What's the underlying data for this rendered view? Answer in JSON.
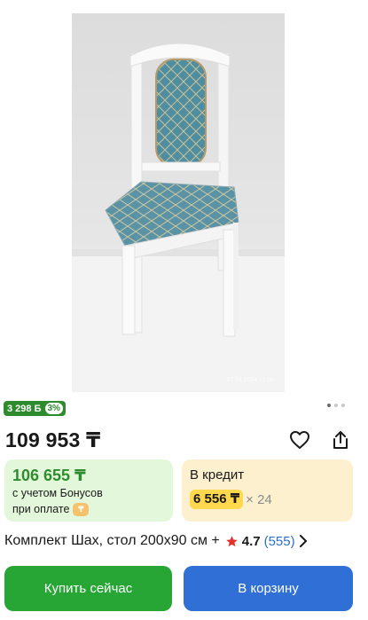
{
  "product": {
    "photo_stamp": "27.09.2024  11:00",
    "image_count": 3,
    "active_image": 1,
    "bonus_badge": {
      "amount": "3 298 Б",
      "percent": "3%"
    },
    "price": "109 953 ₸",
    "title": "Комплект Шах, стол 200x90 см +",
    "rating": "4.7",
    "reviews": "(555)"
  },
  "bonus_card": {
    "price": "106 655 ₸",
    "line1": "с учетом Бонусов",
    "line2": "при оплате",
    "pay_icon": "₸"
  },
  "credit_card": {
    "title": "В кредит",
    "monthly": "6 556 ₸",
    "multiplier": "× 24"
  },
  "actions": {
    "buy_now": "Купить сейчас",
    "add_to_cart": "В корзину"
  },
  "colors": {
    "green": "#27a635",
    "blue": "#2f6fd6",
    "bonus_green": "#2e8c2e",
    "credit_yellow": "#ffd84d",
    "star": "#e3322c"
  },
  "icons": [
    "heart-icon",
    "share-icon",
    "star-icon",
    "chevron-right-icon",
    "bonus-pay-icon"
  ]
}
